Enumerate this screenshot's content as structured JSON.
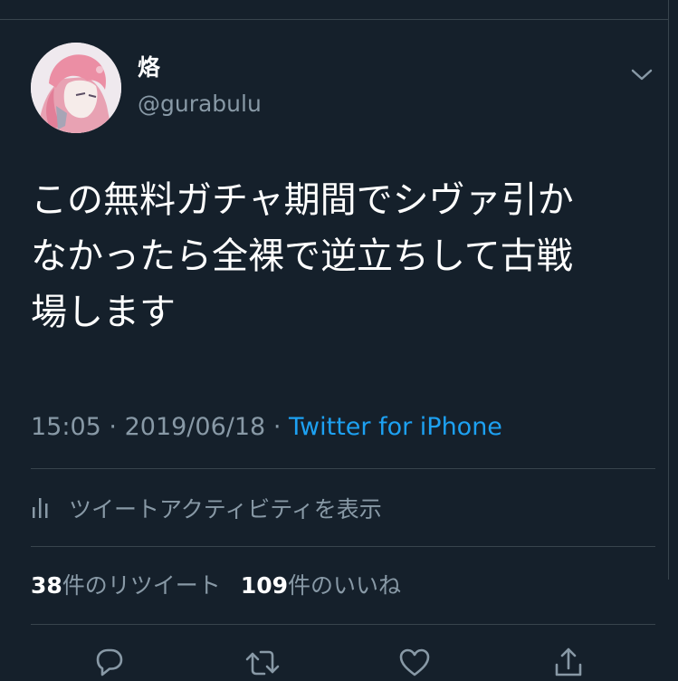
{
  "user": {
    "display_name": "烙",
    "handle": "@gurabulu"
  },
  "tweet": {
    "text_line1": "この無料ガチャ期間でシヴァ引か",
    "text_line2": "なかったら全裸で逆立ちして古戦",
    "text_line3": "場します",
    "time": "15:05",
    "separator": "·",
    "date": "2019/06/18",
    "source": "Twitter for iPhone"
  },
  "activity": {
    "label": "ツイートアクティビティを表示",
    "icon": "bar-chart-icon"
  },
  "stats": {
    "retweets_count": "38",
    "retweets_label": "件のリツイート",
    "likes_count": "109",
    "likes_label": "件のいいね"
  },
  "actions": {
    "reply_icon": "reply-icon",
    "retweet_icon": "retweet-icon",
    "like_icon": "heart-icon",
    "share_icon": "share-icon"
  },
  "colors": {
    "background": "#15202b",
    "text": "#ffffff",
    "secondary_text": "#8899a6",
    "link": "#1da1f2",
    "divider": "#38444d"
  }
}
